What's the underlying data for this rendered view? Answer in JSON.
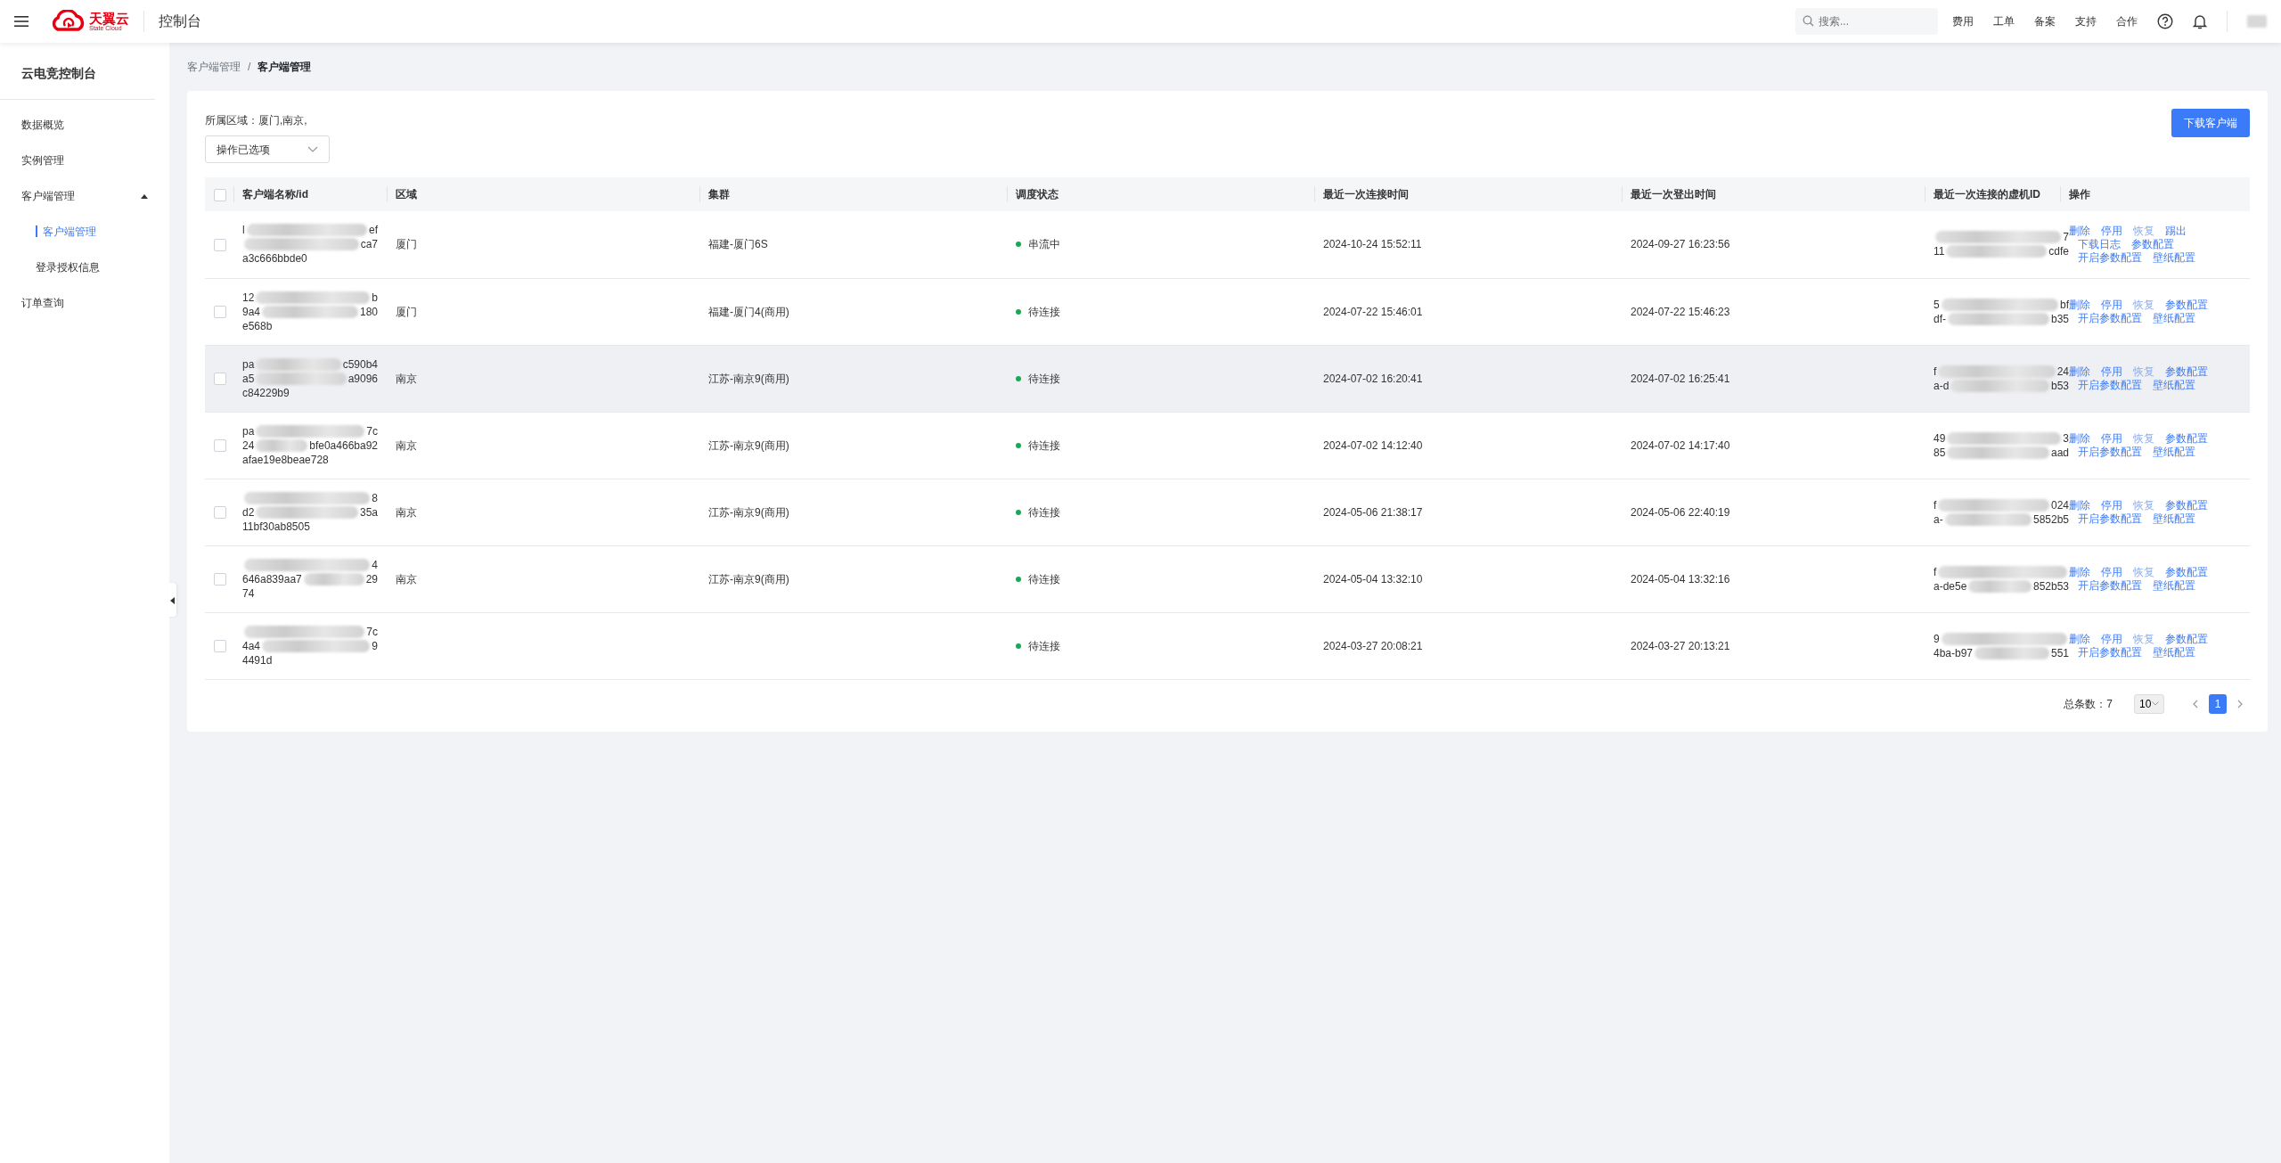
{
  "topbar": {
    "logo_title": "天翼云",
    "logo_subtitle": "State Cloud",
    "console": "控制台",
    "search": {
      "placeholder": "搜索..."
    },
    "links": [
      "费用",
      "工单",
      "备案",
      "支持",
      "合作"
    ],
    "user": {
      "kind": "redaction"
    }
  },
  "sidebar": {
    "title": "云电竞控制台",
    "items": [
      {
        "label": "数据概览",
        "selected": false
      },
      {
        "label": "实例管理",
        "selected": false
      },
      {
        "label": "客户端管理",
        "selected": false,
        "expanded": true,
        "children": [
          {
            "label": "客户端管理",
            "selected": true
          },
          {
            "label": "登录授权信息",
            "selected": false
          }
        ]
      },
      {
        "label": "订单查询",
        "selected": false
      }
    ]
  },
  "breadcrumb": {
    "items": [
      "客户端管理",
      "客户端管理"
    ],
    "separator": "/"
  },
  "filter": {
    "label": "所属区域：厦门,南京,",
    "dropdown": "操作已选项"
  },
  "download_button": "下载客户端",
  "table": {
    "header_checked": false,
    "columns": [
      "客户端名称/id",
      "区域",
      "集群",
      "调度状态",
      "最近一次连接时间",
      "最近一次登出时间",
      "最近一次连接的虚机ID",
      "操作"
    ],
    "rows": [
      {
        "checked": false,
        "highlighted": false,
        "name_lines": [
          [
            {
              "kind": "text",
              "text": "l"
            },
            {
              "kind": "redaction"
            },
            {
              "kind": "text",
              "text": "ef"
            }
          ],
          [
            {
              "kind": "redaction"
            },
            {
              "kind": "text",
              "text": "ca7"
            }
          ],
          [
            {
              "kind": "text",
              "text": "a3c666bbde0"
            }
          ]
        ],
        "region": "厦门",
        "cluster": "福建-厦门6S",
        "status": {
          "label": "串流中",
          "color": "#18a957"
        },
        "connect_time": "2024-10-24 15:52:11",
        "logout_time": "2024-09-27 16:23:56",
        "vm_lines": [
          [
            {
              "kind": "redaction"
            },
            {
              "kind": "text",
              "text": "7"
            }
          ],
          [
            {
              "kind": "text",
              "text": "11"
            },
            {
              "kind": "redaction"
            },
            {
              "kind": "text",
              "text": "cdfe"
            }
          ]
        ],
        "action_lines": [
          [
            {
              "label": "删除",
              "disabled": false
            },
            {
              "label": "停用",
              "disabled": false
            },
            {
              "label": "恢复",
              "disabled": true
            },
            {
              "label": "踢出",
              "disabled": false
            }
          ],
          [
            {
              "label": "下载日志",
              "disabled": false
            },
            {
              "label": "参数配置",
              "disabled": false
            }
          ],
          [
            {
              "label": "开启参数配置",
              "disabled": false
            },
            {
              "label": "壁纸配置",
              "disabled": false
            }
          ]
        ]
      },
      {
        "checked": false,
        "highlighted": false,
        "name_lines": [
          [
            {
              "kind": "text",
              "text": "12"
            },
            {
              "kind": "redaction"
            },
            {
              "kind": "text",
              "text": "b"
            }
          ],
          [
            {
              "kind": "text",
              "text": "9a4"
            },
            {
              "kind": "redaction"
            },
            {
              "kind": "text",
              "text": "180"
            }
          ],
          [
            {
              "kind": "text",
              "text": "e568b"
            }
          ]
        ],
        "region": "厦门",
        "cluster": "福建-厦门4(商用)",
        "status": {
          "label": "待连接",
          "color": "#18a957"
        },
        "connect_time": "2024-07-22 15:46:01",
        "logout_time": "2024-07-22 15:46:23",
        "vm_lines": [
          [
            {
              "kind": "text",
              "text": "5"
            },
            {
              "kind": "redaction"
            },
            {
              "kind": "text",
              "text": "bf"
            }
          ],
          [
            {
              "kind": "text",
              "text": "df-"
            },
            {
              "kind": "redaction"
            },
            {
              "kind": "text",
              "text": "b35"
            }
          ]
        ],
        "action_lines": [
          [
            {
              "label": "删除",
              "disabled": false
            },
            {
              "label": "停用",
              "disabled": false
            },
            {
              "label": "恢复",
              "disabled": true
            },
            {
              "label": "参数配置",
              "disabled": false
            }
          ],
          [
            {
              "label": "开启参数配置",
              "disabled": false
            },
            {
              "label": "壁纸配置",
              "disabled": false
            }
          ]
        ]
      },
      {
        "checked": false,
        "highlighted": true,
        "name_lines": [
          [
            {
              "kind": "text",
              "text": "pa"
            },
            {
              "kind": "redaction"
            },
            {
              "kind": "text",
              "text": "c590b4"
            }
          ],
          [
            {
              "kind": "text",
              "text": "a5"
            },
            {
              "kind": "redaction"
            },
            {
              "kind": "text",
              "text": "a9096"
            }
          ],
          [
            {
              "kind": "text",
              "text": "c84229b9"
            }
          ]
        ],
        "region": "南京",
        "cluster": "江苏-南京9(商用)",
        "status": {
          "label": "待连接",
          "color": "#18a957"
        },
        "connect_time": "2024-07-02 16:20:41",
        "logout_time": "2024-07-02 16:25:41",
        "vm_lines": [
          [
            {
              "kind": "text",
              "text": "f"
            },
            {
              "kind": "redaction"
            },
            {
              "kind": "text",
              "text": "24"
            }
          ],
          [
            {
              "kind": "text",
              "text": "a-d"
            },
            {
              "kind": "redaction"
            },
            {
              "kind": "text",
              "text": "b53"
            }
          ]
        ],
        "action_lines": [
          [
            {
              "label": "删除",
              "disabled": false
            },
            {
              "label": "停用",
              "disabled": false
            },
            {
              "label": "恢复",
              "disabled": true
            },
            {
              "label": "参数配置",
              "disabled": false
            }
          ],
          [
            {
              "label": "开启参数配置",
              "disabled": false
            },
            {
              "label": "壁纸配置",
              "disabled": false
            }
          ]
        ]
      },
      {
        "checked": false,
        "highlighted": false,
        "name_lines": [
          [
            {
              "kind": "text",
              "text": "pa"
            },
            {
              "kind": "redaction"
            },
            {
              "kind": "text",
              "text": "7c"
            }
          ],
          [
            {
              "kind": "text",
              "text": "24"
            },
            {
              "kind": "redaction"
            },
            {
              "kind": "text",
              "text": "bfe0a466ba92"
            }
          ],
          [
            {
              "kind": "text",
              "text": "afae19e8beae728"
            }
          ]
        ],
        "region": "南京",
        "cluster": "江苏-南京9(商用)",
        "status": {
          "label": "待连接",
          "color": "#18a957"
        },
        "connect_time": "2024-07-02 14:12:40",
        "logout_time": "2024-07-02 14:17:40",
        "vm_lines": [
          [
            {
              "kind": "text",
              "text": "49"
            },
            {
              "kind": "redaction"
            },
            {
              "kind": "text",
              "text": "3"
            }
          ],
          [
            {
              "kind": "text",
              "text": "85"
            },
            {
              "kind": "redaction"
            },
            {
              "kind": "text",
              "text": "aad"
            }
          ]
        ],
        "action_lines": [
          [
            {
              "label": "删除",
              "disabled": false
            },
            {
              "label": "停用",
              "disabled": false
            },
            {
              "label": "恢复",
              "disabled": true
            },
            {
              "label": "参数配置",
              "disabled": false
            }
          ],
          [
            {
              "label": "开启参数配置",
              "disabled": false
            },
            {
              "label": "壁纸配置",
              "disabled": false
            }
          ]
        ]
      },
      {
        "checked": false,
        "highlighted": false,
        "name_lines": [
          [
            {
              "kind": "redaction"
            },
            {
              "kind": "text",
              "text": "8"
            }
          ],
          [
            {
              "kind": "text",
              "text": "d2"
            },
            {
              "kind": "redaction"
            },
            {
              "kind": "text",
              "text": "35a"
            }
          ],
          [
            {
              "kind": "text",
              "text": "11bf30ab8505"
            }
          ]
        ],
        "region": "南京",
        "cluster": "江苏-南京9(商用)",
        "status": {
          "label": "待连接",
          "color": "#18a957"
        },
        "connect_time": "2024-05-06 21:38:17",
        "logout_time": "2024-05-06 22:40:19",
        "vm_lines": [
          [
            {
              "kind": "text",
              "text": "f"
            },
            {
              "kind": "redaction"
            },
            {
              "kind": "text",
              "text": "024"
            }
          ],
          [
            {
              "kind": "text",
              "text": "a-"
            },
            {
              "kind": "redaction"
            },
            {
              "kind": "text",
              "text": "5852b5"
            }
          ]
        ],
        "action_lines": [
          [
            {
              "label": "删除",
              "disabled": false
            },
            {
              "label": "停用",
              "disabled": false
            },
            {
              "label": "恢复",
              "disabled": true
            },
            {
              "label": "参数配置",
              "disabled": false
            }
          ],
          [
            {
              "label": "开启参数配置",
              "disabled": false
            },
            {
              "label": "壁纸配置",
              "disabled": false
            }
          ]
        ]
      },
      {
        "checked": false,
        "highlighted": false,
        "name_lines": [
          [
            {
              "kind": "redaction"
            },
            {
              "kind": "text",
              "text": "4"
            }
          ],
          [
            {
              "kind": "text",
              "text": "646a839aa7"
            },
            {
              "kind": "redaction"
            },
            {
              "kind": "text",
              "text": "29"
            }
          ],
          [
            {
              "kind": "text",
              "text": "74"
            }
          ]
        ],
        "region": "南京",
        "cluster": "江苏-南京9(商用)",
        "status": {
          "label": "待连接",
          "color": "#18a957"
        },
        "connect_time": "2024-05-04 13:32:10",
        "logout_time": "2024-05-04 13:32:16",
        "vm_lines": [
          [
            {
              "kind": "text",
              "text": "f"
            },
            {
              "kind": "redaction"
            }
          ],
          [
            {
              "kind": "text",
              "text": "a-de5e"
            },
            {
              "kind": "redaction"
            },
            {
              "kind": "text",
              "text": "852b53"
            }
          ]
        ],
        "action_lines": [
          [
            {
              "label": "删除",
              "disabled": false
            },
            {
              "label": "停用",
              "disabled": false
            },
            {
              "label": "恢复",
              "disabled": true
            },
            {
              "label": "参数配置",
              "disabled": false
            }
          ],
          [
            {
              "label": "开启参数配置",
              "disabled": false
            },
            {
              "label": "壁纸配置",
              "disabled": false
            }
          ]
        ]
      },
      {
        "checked": false,
        "highlighted": false,
        "name_lines": [
          [
            {
              "kind": "redaction"
            },
            {
              "kind": "text",
              "text": "7c"
            }
          ],
          [
            {
              "kind": "text",
              "text": "4a4"
            },
            {
              "kind": "redaction"
            },
            {
              "kind": "text",
              "text": "9"
            }
          ],
          [
            {
              "kind": "text",
              "text": "4491d"
            }
          ]
        ],
        "status": {
          "label": "待连接",
          "color": "#18a957"
        },
        "connect_time": "2024-03-27 20:08:21",
        "logout_time": "2024-03-27 20:13:21",
        "vm_lines": [
          [
            {
              "kind": "text",
              "text": "9"
            },
            {
              "kind": "redaction"
            }
          ],
          [
            {
              "kind": "text",
              "text": "4ba-b97"
            },
            {
              "kind": "redaction"
            },
            {
              "kind": "text",
              "text": "551"
            }
          ]
        ],
        "action_lines": [
          [
            {
              "label": "删除",
              "disabled": false
            },
            {
              "label": "停用",
              "disabled": false
            },
            {
              "label": "恢复",
              "disabled": true
            },
            {
              "label": "参数配置",
              "disabled": false
            }
          ],
          [
            {
              "label": "开启参数配置",
              "disabled": false
            },
            {
              "label": "壁纸配置",
              "disabled": false
            }
          ]
        ]
      }
    ]
  },
  "pagination": {
    "total": "总条数：7",
    "page_size": "10",
    "pages": [
      {
        "label": "1",
        "selected": true
      }
    ]
  }
}
